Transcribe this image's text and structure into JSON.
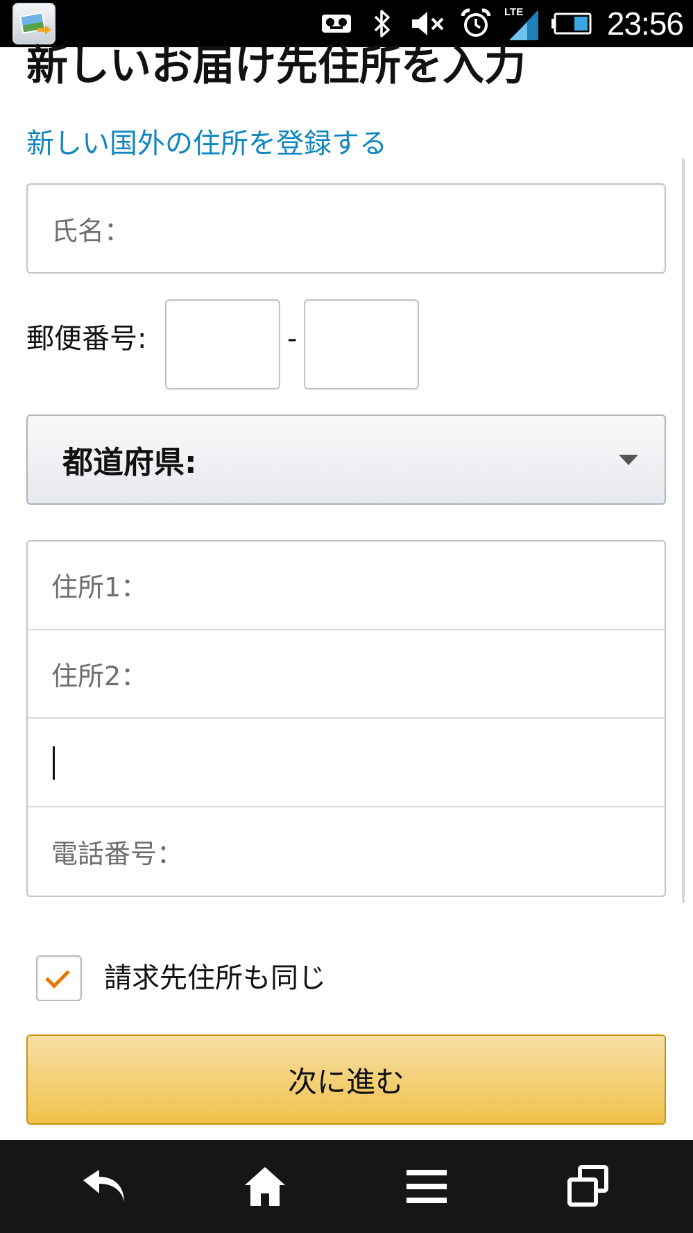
{
  "status_bar": {
    "time": "23:56",
    "network_type": "LTE",
    "icons": [
      "gallery-app-icon",
      "voicemail-icon",
      "bluetooth-icon",
      "mute-icon",
      "alarm-icon",
      "signal-icon",
      "battery-icon"
    ]
  },
  "form": {
    "title": "新しいお届け先住所を入力",
    "international_link": "新しい国外の住所を登録する",
    "name_placeholder": "氏名：",
    "postal_label": "郵便番号:",
    "postal_separator": "-",
    "prefecture_label": "都道府県:",
    "address1_placeholder": "住所1：",
    "address2_placeholder": "住所2：",
    "address3_value": "",
    "phone_placeholder": "電話番号：",
    "billing_same_label": "請求先住所も同じ",
    "billing_same_checked": true,
    "next_button_label": "次に進む"
  },
  "colors": {
    "link": "#0f86bf",
    "button": "#f0c14b",
    "checkmark": "#e77600"
  },
  "nav_bar": {
    "icons": [
      "back-icon",
      "home-icon",
      "menu-icon",
      "recent-apps-icon"
    ]
  }
}
